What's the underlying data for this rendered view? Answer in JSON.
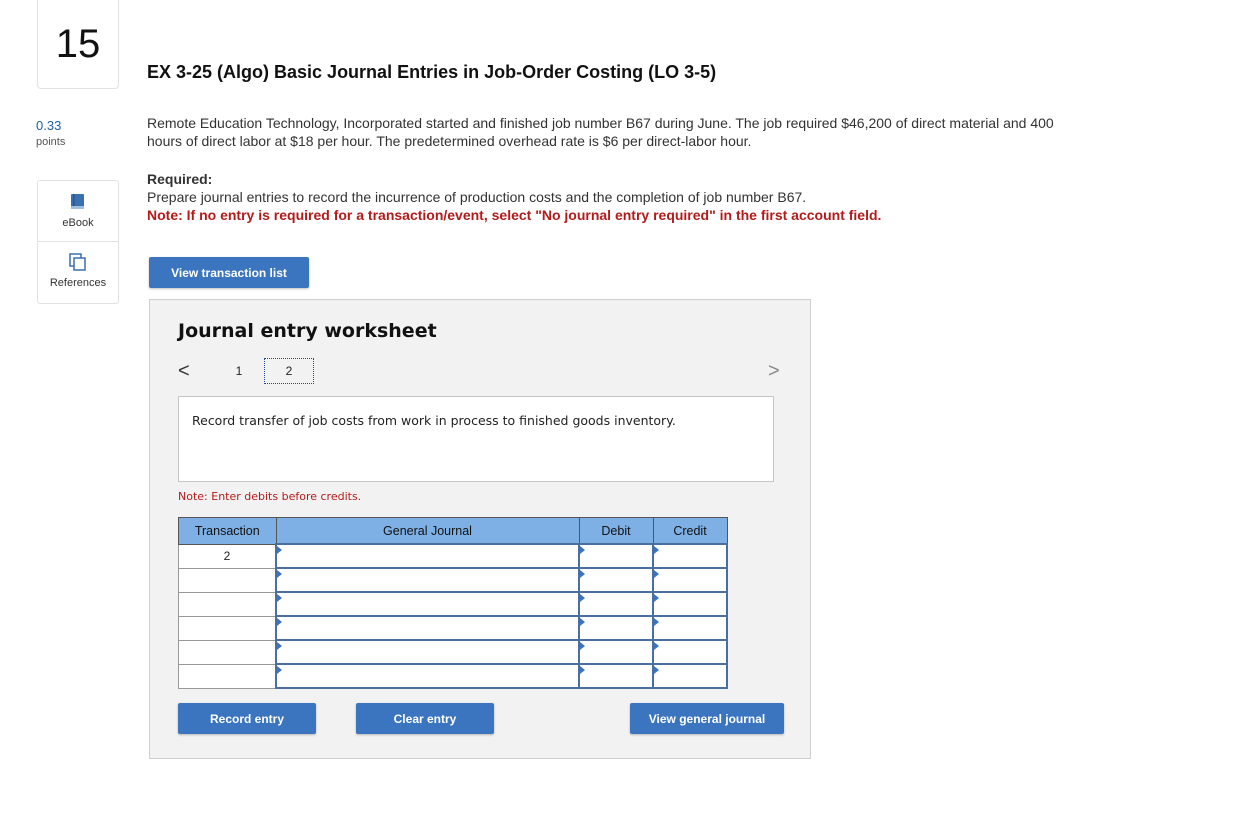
{
  "question": {
    "number": "15",
    "points_value": "0.33",
    "points_label": "points"
  },
  "tools": [
    {
      "label": "eBook",
      "icon": "book-icon"
    },
    {
      "label": "References",
      "icon": "references-icon"
    }
  ],
  "problem": {
    "title": "EX 3-25 (Algo) Basic Journal Entries in Job-Order Costing (LO 3-5)",
    "description": "Remote Education Technology, Incorporated started and finished job number B67 during June. The job required $46,200 of direct material and 400 hours of direct labor at $18 per hour. The predetermined overhead rate is $6 per direct-labor hour.",
    "required_heading": "Required:",
    "required_text": "Prepare journal entries to record the incurrence of production costs and the completion of job number B67.",
    "note": "Note: If no entry is required for a transaction/event, select \"No journal entry required\" in the first account field."
  },
  "buttons": {
    "view_transaction_list": "View transaction list",
    "record_entry": "Record entry",
    "clear_entry": "Clear entry",
    "view_general_journal": "View general journal"
  },
  "worksheet": {
    "title": "Journal entry worksheet",
    "prev_symbol": "<",
    "next_symbol": ">",
    "pages": [
      "1",
      "2"
    ],
    "current_page": "2",
    "instruction": "Record transfer of job costs from work in process to finished goods inventory.",
    "entry_note": "Note: Enter debits before credits.",
    "columns": [
      "Transaction",
      "General Journal",
      "Debit",
      "Credit"
    ],
    "rows": [
      {
        "transaction": "2",
        "account": "",
        "debit": "",
        "credit": ""
      },
      {
        "transaction": "",
        "account": "",
        "debit": "",
        "credit": ""
      },
      {
        "transaction": "",
        "account": "",
        "debit": "",
        "credit": ""
      },
      {
        "transaction": "",
        "account": "",
        "debit": "",
        "credit": ""
      },
      {
        "transaction": "",
        "account": "",
        "debit": "",
        "credit": ""
      },
      {
        "transaction": "",
        "account": "",
        "debit": "",
        "credit": ""
      }
    ]
  },
  "colors": {
    "button_blue": "#3b75c0",
    "header_blue": "#7eb0e6",
    "note_red": "#b31b1b",
    "points_blue": "#1c5e9e"
  }
}
